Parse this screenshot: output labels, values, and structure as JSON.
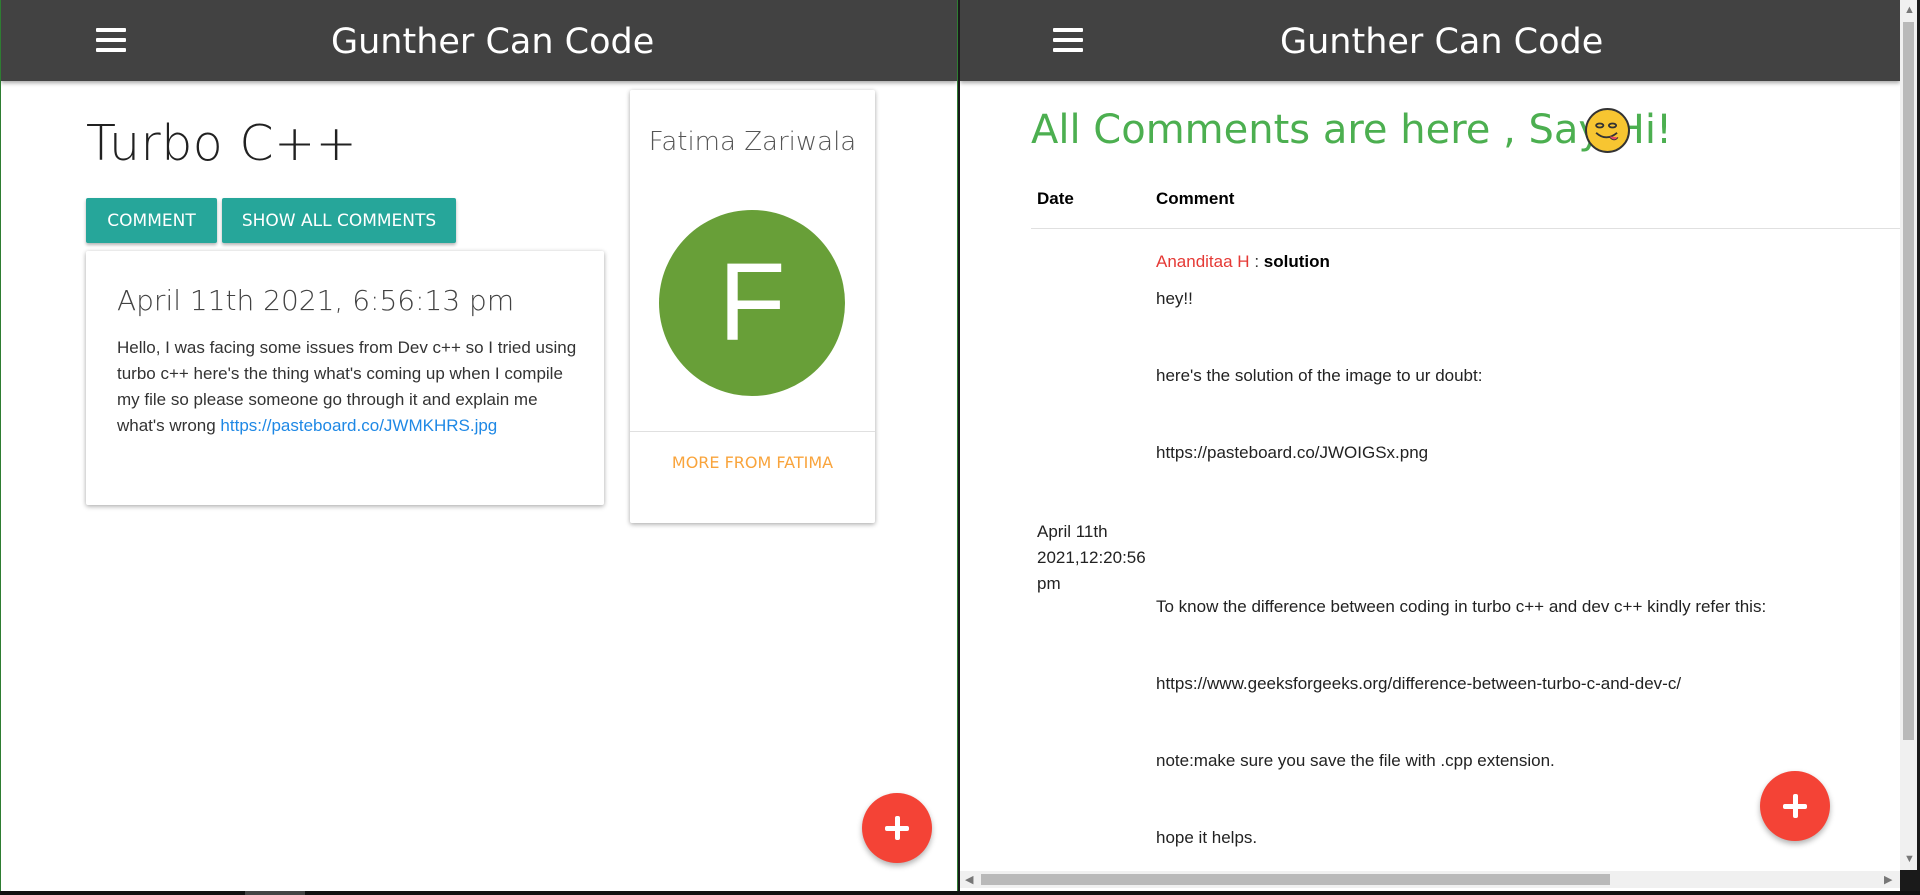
{
  "left": {
    "nav_title": "Gunther Can Code",
    "post": {
      "title": "Turbo C++",
      "comment_button": "COMMENT",
      "show_all_button": "SHOW ALL COMMENTS",
      "date": "April 11th 2021, 6:56:13 pm",
      "body": "Hello, I was facing some issues from Dev c++ so I tried using turbo c++ here's the thing what's coming up when I compile my file so please someone go through it and explain me what's wrong",
      "link": "https://pasteboard.co/JWMKHRS.jpg"
    },
    "author": {
      "name": "Fatima Zariwala",
      "initial": "F",
      "more_link": "MORE FROM FATIMA",
      "avatar_color": "#689f38"
    }
  },
  "right": {
    "nav_title": "Gunther Can Code",
    "heading": "All Comments are here , Say Hi!",
    "columns": {
      "date": "Date",
      "comment": "Comment"
    },
    "comment": {
      "author": "Ananditaa H",
      "separator": ":",
      "subject": "solution",
      "date": "April 11th 2021,12:20:56 pm",
      "lines": [
        "hey!!",
        "here's the solution of the image to ur doubt:",
        "https://pasteboard.co/JWOIGSx.png",
        "To know the difference between coding in turbo c++ and dev c++ kindly refer this:",
        "https://www.geeksforgeeks.org/difference-between-turbo-c-and-dev-c/",
        "note:make sure  you save the file with .cpp extension.",
        "hope it helps."
      ]
    }
  },
  "colors": {
    "navbar": "#424242",
    "button": "#26a69a",
    "fab": "#f44336",
    "heading": "#4caf50",
    "author_name": "#e53935",
    "more_link": "#f9a43c",
    "link": "#1e88e5"
  },
  "icons": {
    "menu": "hamburger-menu-icon",
    "fab": "plus-icon",
    "emoji": "smiling-face-icon"
  }
}
